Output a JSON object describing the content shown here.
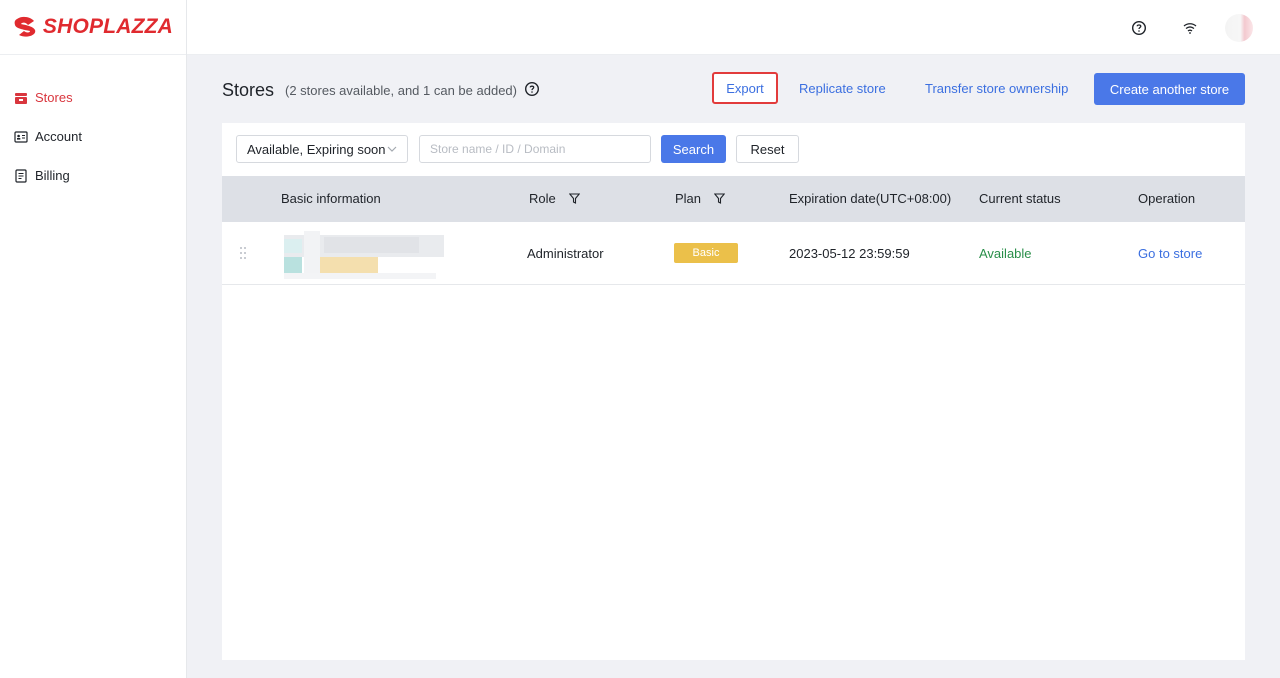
{
  "brand": {
    "name": "SHOPLAZZA",
    "color": "#e02a2f"
  },
  "sidebar": {
    "items": [
      {
        "label": "Stores",
        "icon": "store-icon",
        "active": true
      },
      {
        "label": "Account",
        "icon": "id-card-icon",
        "active": false
      },
      {
        "label": "Billing",
        "icon": "document-icon",
        "active": false
      }
    ]
  },
  "header": {
    "icons": [
      "help-circle-icon",
      "wifi-icon",
      "avatar"
    ]
  },
  "page": {
    "title": "Stores",
    "subtitle": "(2 stores available, and 1 can be added)",
    "actions": {
      "export": "Export",
      "replicate": "Replicate store",
      "transfer": "Transfer store ownership",
      "create": "Create another store"
    }
  },
  "filters": {
    "status_select": "Available, Expiring soon",
    "search_placeholder": "Store name / ID / Domain",
    "search_value": "",
    "search_button": "Search",
    "reset_button": "Reset"
  },
  "table": {
    "headers": {
      "basic": "Basic information",
      "role": "Role",
      "plan": "Plan",
      "expiration": "Expiration date(UTC+08:00)",
      "status": "Current status",
      "operation": "Operation"
    },
    "rows": [
      {
        "role": "Administrator",
        "plan": "Basic",
        "expiration": "2023-05-12 23:59:59",
        "status": "Available",
        "operation": "Go to store"
      }
    ]
  },
  "colors": {
    "accent": "#4a78e8",
    "link": "#3b6fe0",
    "active_nav": "#d9363e",
    "export_highlight": "#e23b3b",
    "plan_badge": "#ebc04a",
    "status_available": "#2a8f4a"
  }
}
